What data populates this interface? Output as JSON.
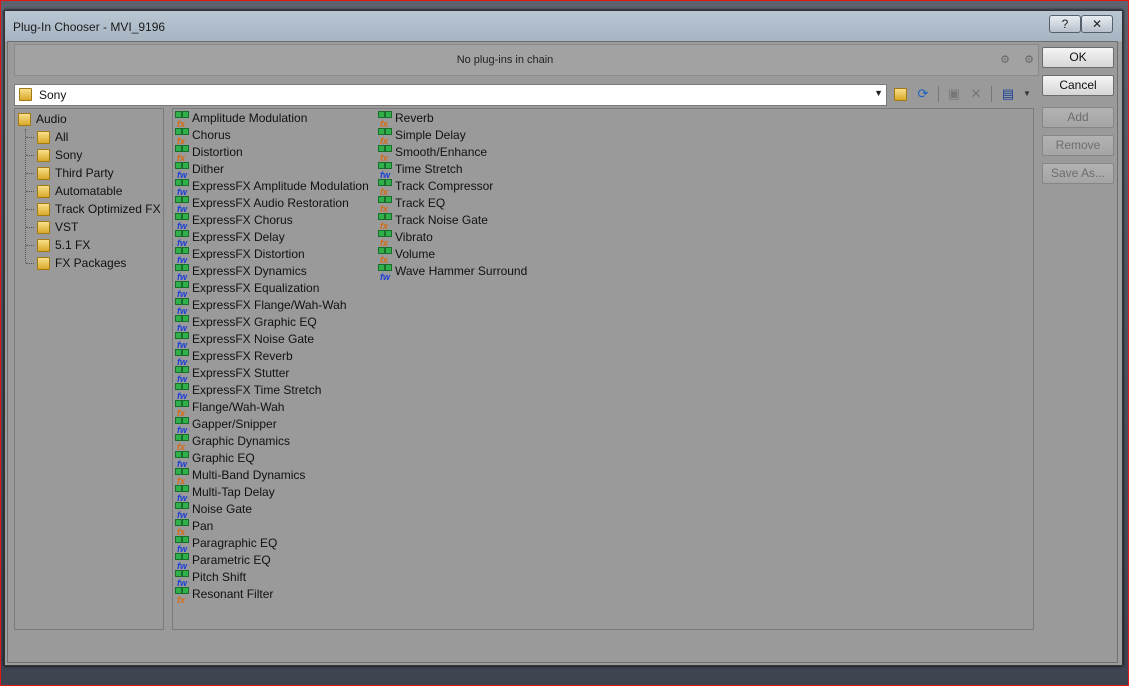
{
  "window": {
    "title": "Plug-In Chooser - MVI_9196",
    "help_label": "?",
    "close_label": "✕"
  },
  "chain": {
    "status": "No plug-ins in chain"
  },
  "location": {
    "value": "Sony"
  },
  "tree": {
    "root": "Audio",
    "children": [
      "All",
      "Sony",
      "Third Party",
      "Automatable",
      "Track Optimized FX",
      "VST",
      "5.1 FX",
      "FX Packages"
    ]
  },
  "plugins": {
    "column1": [
      {
        "name": "Amplitude Modulation",
        "icon": "directx-plugin-icon"
      },
      {
        "name": "Chorus",
        "icon": "directx-plugin-icon"
      },
      {
        "name": "Distortion",
        "icon": "directx-plugin-icon"
      },
      {
        "name": "Dither",
        "icon": "vst-plugin-icon"
      },
      {
        "name": "ExpressFX Amplitude Modulation",
        "icon": "vst-plugin-icon"
      },
      {
        "name": "ExpressFX Audio Restoration",
        "icon": "vst-plugin-icon"
      },
      {
        "name": "ExpressFX Chorus",
        "icon": "vst-plugin-icon"
      },
      {
        "name": "ExpressFX Delay",
        "icon": "vst-plugin-icon"
      },
      {
        "name": "ExpressFX Distortion",
        "icon": "vst-plugin-icon"
      },
      {
        "name": "ExpressFX Dynamics",
        "icon": "vst-plugin-icon"
      },
      {
        "name": "ExpressFX Equalization",
        "icon": "vst-plugin-icon"
      },
      {
        "name": "ExpressFX Flange/Wah-Wah",
        "icon": "vst-plugin-icon"
      },
      {
        "name": "ExpressFX Graphic EQ",
        "icon": "vst-plugin-icon"
      },
      {
        "name": "ExpressFX Noise Gate",
        "icon": "vst-plugin-icon"
      },
      {
        "name": "ExpressFX Reverb",
        "icon": "vst-plugin-icon"
      },
      {
        "name": "ExpressFX Stutter",
        "icon": "vst-plugin-icon"
      },
      {
        "name": "ExpressFX Time Stretch",
        "icon": "vst-plugin-icon"
      },
      {
        "name": "Flange/Wah-Wah",
        "icon": "directx-plugin-icon"
      },
      {
        "name": "Gapper/Snipper",
        "icon": "vst-plugin-icon"
      },
      {
        "name": "Graphic Dynamics",
        "icon": "directx-plugin-icon"
      },
      {
        "name": "Graphic EQ",
        "icon": "vst-plugin-icon"
      },
      {
        "name": "Multi-Band Dynamics",
        "icon": "directx-plugin-icon"
      },
      {
        "name": "Multi-Tap Delay",
        "icon": "vst-plugin-icon"
      },
      {
        "name": "Noise Gate",
        "icon": "vst-plugin-icon"
      },
      {
        "name": "Pan",
        "icon": "directx-plugin-icon"
      },
      {
        "name": "Paragraphic EQ",
        "icon": "vst-plugin-icon"
      },
      {
        "name": "Parametric EQ",
        "icon": "vst-plugin-icon"
      },
      {
        "name": "Pitch Shift",
        "icon": "vst-plugin-icon"
      },
      {
        "name": "Resonant Filter",
        "icon": "directx-plugin-icon"
      }
    ],
    "column2": [
      {
        "name": "Reverb",
        "icon": "directx-plugin-icon"
      },
      {
        "name": "Simple Delay",
        "icon": "directx-plugin-icon"
      },
      {
        "name": "Smooth/Enhance",
        "icon": "directx-plugin-icon"
      },
      {
        "name": "Time Stretch",
        "icon": "vst-plugin-icon"
      },
      {
        "name": "Track Compressor",
        "icon": "directx-plugin-icon"
      },
      {
        "name": "Track EQ",
        "icon": "directx-plugin-icon"
      },
      {
        "name": "Track Noise Gate",
        "icon": "directx-plugin-icon"
      },
      {
        "name": "Vibrato",
        "icon": "directx-plugin-icon"
      },
      {
        "name": "Volume",
        "icon": "directx-plugin-icon"
      },
      {
        "name": "Wave Hammer Surround",
        "icon": "vst-plugin-icon"
      }
    ]
  },
  "buttons": {
    "ok": "OK",
    "cancel": "Cancel",
    "add": "Add",
    "remove": "Remove",
    "save_as": "Save As..."
  },
  "colors": {
    "frame_highlight": "#e01818",
    "panel_bg": "#9a9a9a"
  }
}
